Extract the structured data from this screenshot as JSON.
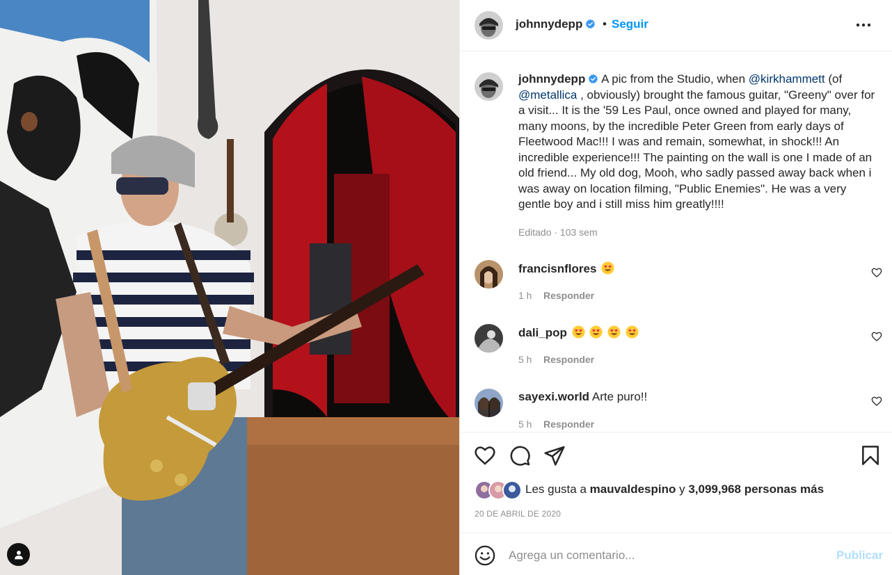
{
  "colors": {
    "accent": "#0095f6",
    "mention": "#00376b",
    "muted": "#8e8e8e",
    "publish_disabled": "#b2dffc",
    "verified": "#3897f0"
  },
  "photo": {
    "alt": "",
    "user_tag_icon": "user-tag-icon"
  },
  "header": {
    "username": "johnnydepp",
    "verified_icon": "verified-badge-icon",
    "separator": "•",
    "follow_label": "Seguir",
    "more_icon": "more-options-icon"
  },
  "caption": {
    "username": "johnnydepp",
    "part1": " A pic from the Studio, when ",
    "mention1": "@kirkhammett",
    "part2": " (of ",
    "mention2": "@metallica",
    "part3": " , obviously) brought the famous guitar, \"Greeny\" over for a visit... It is the '59 Les Paul, once owned and played for many, many moons, by the incredible Peter Green from early days of Fleetwood Mac!!! I was and remain, somewhat, in shock!!! An incredible experience!!! The painting on the wall is one I made of an old friend... My old dog, Mooh, who sadly passed away back when i was away on location filming, \"Public Enemies\". He was a very gentle boy and i still miss him greatly!!!!",
    "meta": "Editado · 103 sem"
  },
  "comments": [
    {
      "username": "francisnflores",
      "text": "",
      "emoji_count": 1,
      "time": "1 h",
      "reply_label": "Responder"
    },
    {
      "username": "dali_pop",
      "text": "",
      "emoji_count": 4,
      "time": "5 h",
      "reply_label": "Responder"
    },
    {
      "username": "sayexi.world",
      "text": "Arte puro!!",
      "emoji_count": 0,
      "time": "5 h",
      "reply_label": "Responder"
    }
  ],
  "actions": {
    "like_icon": "heart-icon",
    "comment_icon": "comment-icon",
    "share_icon": "share-icon",
    "save_icon": "bookmark-icon"
  },
  "likes": {
    "prefix": "Les gusta a ",
    "user": "mauvaldespino",
    "middle": " y ",
    "count": "3,099,968 personas más"
  },
  "date": "20 DE ABRIL DE 2020",
  "add_comment": {
    "placeholder": "Agrega un comentario...",
    "publish_label": "Publicar",
    "emoji_icon": "emoji-icon"
  }
}
